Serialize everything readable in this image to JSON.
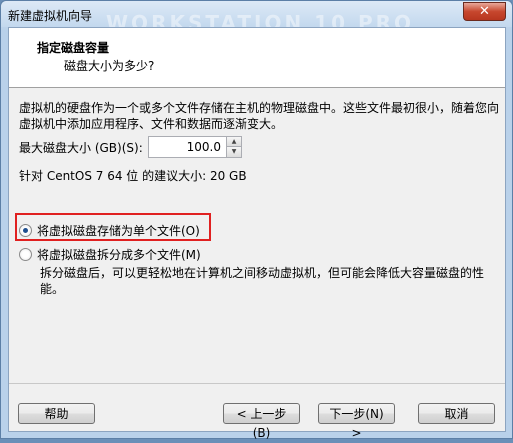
{
  "window": {
    "title": "新建虚拟机向导",
    "watermark": "WORKSTATION 10 PRO",
    "close_symbol": "✕"
  },
  "header": {
    "title": "指定磁盘容量",
    "subtitle": "磁盘大小为多少?"
  },
  "description": "虚拟机的硬盘作为一个或多个文件存储在主机的物理磁盘中。这些文件最初很小，随着您向虚拟机中添加应用程序、文件和数据而逐渐变大。",
  "disk": {
    "label": "最大磁盘大小 (GB)(S):",
    "value": "100.0",
    "recommend": "针对 CentOS 7 64 位 的建议大小: 20 GB"
  },
  "options": {
    "single": {
      "label": "将虚拟磁盘存储为单个文件(O)",
      "checked": true
    },
    "split": {
      "label": "将虚拟磁盘拆分成多个文件(M)",
      "checked": false,
      "description": "拆分磁盘后，可以更轻松地在计算机之间移动虚拟机，但可能会降低大容量磁盘的性能。"
    }
  },
  "buttons": {
    "help": "帮助",
    "back": "< 上一步(B)",
    "next": "下一步(N) >",
    "cancel": "取消"
  },
  "colors": {
    "highlight": "#e02020",
    "title_bar": "#c3d8ee"
  }
}
